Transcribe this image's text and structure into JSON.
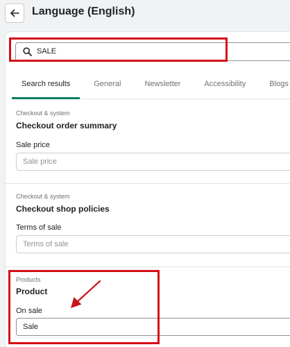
{
  "header": {
    "title": "Language (English)"
  },
  "search": {
    "value": "SALE"
  },
  "tabs": [
    {
      "label": "Search results",
      "active": true
    },
    {
      "label": "General"
    },
    {
      "label": "Newsletter"
    },
    {
      "label": "Accessibility"
    },
    {
      "label": "Blogs"
    }
  ],
  "sections": [
    {
      "category": "Checkout & system",
      "title": "Checkout order summary",
      "field_label": "Sale price",
      "placeholder": "Sale price",
      "value": ""
    },
    {
      "category": "Checkout & system",
      "title": "Checkout shop policies",
      "field_label": "Terms of sale",
      "placeholder": "Terms of sale",
      "value": ""
    },
    {
      "category": "Products",
      "title": "Product",
      "field_label": "On sale",
      "placeholder": "",
      "value": "Sale"
    }
  ],
  "colors": {
    "highlight": "#d50d16",
    "tab_underline": "#008060"
  }
}
